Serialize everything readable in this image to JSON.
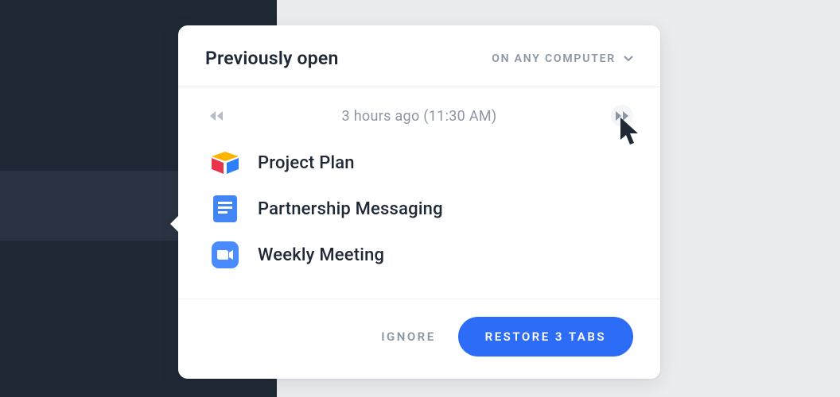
{
  "header": {
    "title": "Previously open",
    "filter_label": "ON ANY COMPUTER"
  },
  "pager": {
    "timestamp": "3 hours ago (11:30 AM)"
  },
  "tabs": [
    {
      "icon": "airtable",
      "title": "Project Plan"
    },
    {
      "icon": "google-docs",
      "title": "Partnership Messaging"
    },
    {
      "icon": "zoom",
      "title": "Weekly Meeting"
    }
  ],
  "footer": {
    "ignore_label": "IGNORE",
    "restore_label": "RESTORE 3 TABS"
  },
  "colors": {
    "sidebar_bg": "#1f2835",
    "sidebar_active": "#2a3341",
    "page_bg": "#ebecee",
    "primary": "#2d6cf6",
    "text": "#1f2835",
    "muted": "#8c95a3"
  }
}
